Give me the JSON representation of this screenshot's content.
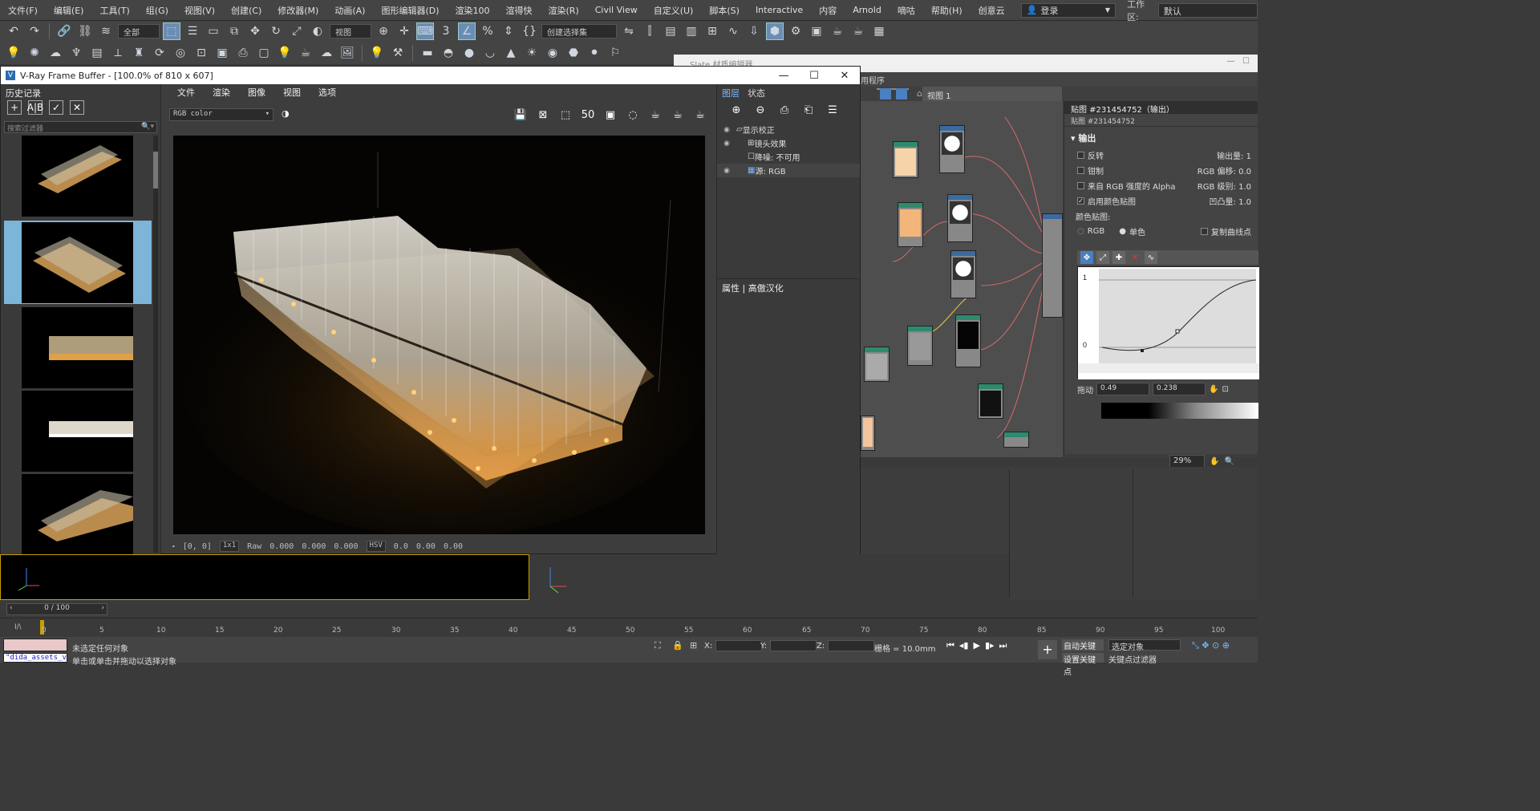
{
  "menubar": {
    "items": [
      "文件(F)",
      "编辑(E)",
      "工具(T)",
      "组(G)",
      "视图(V)",
      "创建(C)",
      "修改器(M)",
      "动画(A)",
      "图形编辑器(D)",
      "渲染100",
      "渲得快",
      "渲染(R)",
      "Civil View",
      "自定义(U)",
      "脚本(S)",
      "Interactive",
      "内容",
      "Arnold",
      "嘀咕",
      "帮助(H)",
      "创意云"
    ],
    "login": "登录",
    "workspace_label": "工作区:",
    "workspace_value": "默认"
  },
  "toolbar1": {
    "filter_value": "全部",
    "ref_coord": "视图",
    "selection_set": "创建选择集"
  },
  "background_window": {
    "title": "Slate 材质编辑器",
    "menu_hint": "用程序",
    "view_tab": "视图 1"
  },
  "material_props": {
    "header": "贴图 #231454752（输出）",
    "sub": "贴图 #231454752",
    "rollout": "输出",
    "rows": [
      {
        "label": "反转",
        "checked": false,
        "right_label": "输出量:",
        "right_value": "1"
      },
      {
        "label": "钳制",
        "checked": false,
        "right_label": "RGB 偏移:",
        "right_value": "0.0"
      },
      {
        "label": "来自 RGB 强度的 Alpha",
        "checked": false,
        "right_label": "RGB 级别:",
        "right_value": "1.0"
      },
      {
        "label": "启用颜色贴图",
        "checked": true,
        "right_label": "凹凸量:",
        "right_value": "1.0"
      }
    ],
    "color_map_label": "颜色贴图:",
    "mode_rgb": "RGB",
    "mode_mono": "单色",
    "copy_curve": "复制曲线点",
    "curve_y_top": "1",
    "curve_y_bottom": "0",
    "drag_label": "拖动",
    "drag_x": "0.49",
    "drag_y": "0.238",
    "zoom_value": "29%"
  },
  "vfb": {
    "title": "V-Ray Frame Buffer - [100.0% of 810 x 607]",
    "window_controls": [
      "—",
      "☐",
      "✕"
    ],
    "history_title": "历史记录",
    "search_placeholder": "搜索过滤器",
    "menu": [
      "文件",
      "渲染",
      "图像",
      "视图",
      "选项"
    ],
    "channel": "RGB color",
    "status": {
      "coords": "[0, 0]",
      "scale": "1x1",
      "raw_label": "Raw",
      "raw_values": [
        "0.000",
        "0.000",
        "0.000"
      ],
      "mode": "HSV",
      "hsv_values": [
        "0.0",
        "0.00",
        "0.00"
      ]
    },
    "layers": {
      "tab_layers": "图层",
      "tab_state": "状态",
      "rows": [
        {
          "label": "显示校正",
          "indent": 0
        },
        {
          "label": "镜头效果",
          "indent": 1
        },
        {
          "label": "降噪: 不可用",
          "indent": 1
        },
        {
          "label": "源: RGB",
          "indent": 1
        }
      ],
      "props_title": "属性 | 高傲汉化"
    }
  },
  "timeline": {
    "slider": "0 / 100",
    "ticks": [
      "0",
      "5",
      "10",
      "15",
      "20",
      "25",
      "30",
      "35",
      "40",
      "45",
      "50",
      "55",
      "60",
      "65",
      "70",
      "75",
      "80",
      "85",
      "90",
      "95",
      "100"
    ]
  },
  "statusbar": {
    "script_text": "\"dida_assets_v",
    "msg": "未选定任何对象",
    "msg2": "单击或单击并拖动以选择对象",
    "x_label": "X:",
    "y_label": "Y:",
    "z_label": "Z:",
    "grid": "栅格 = 10.0mm",
    "autokey": "自动关键点",
    "selected": "选定对象",
    "setkey": "设置关键点",
    "keyfilter": "关键点过滤器"
  }
}
